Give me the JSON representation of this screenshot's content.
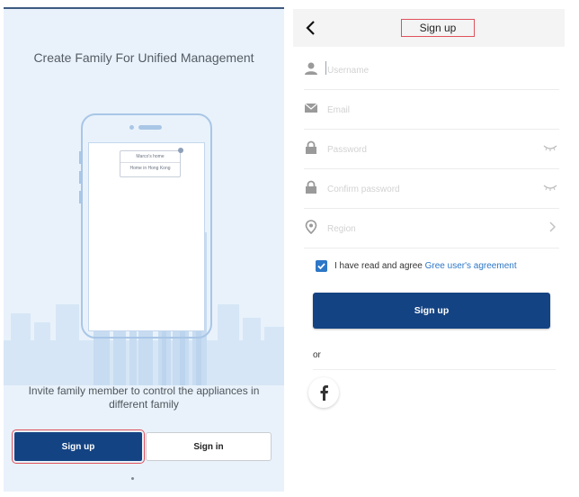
{
  "onboarding": {
    "title": "Create Family For Unified Management",
    "illustration": {
      "popup_line1": "Marco's home",
      "popup_line2": "Home in Hong Kong"
    },
    "invite_text": "Invite family member to control the appliances in different family",
    "signup_label": "Sign up",
    "signin_label": "Sign in",
    "page_indicator": {
      "pages": 1,
      "active": 1
    }
  },
  "signup_form": {
    "header": {
      "title": "Sign up",
      "back_icon": "chevron-left-icon"
    },
    "fields": {
      "username": {
        "placeholder": "Username",
        "value": "",
        "icon": "user-icon"
      },
      "email": {
        "placeholder": "Email",
        "value": "",
        "icon": "mail-icon"
      },
      "password": {
        "placeholder": "Password",
        "value": "",
        "icon": "lock-icon",
        "toggle_icon": "eye-closed-icon"
      },
      "confirm_password": {
        "placeholder": "Confirm password",
        "value": "",
        "icon": "lock-icon",
        "toggle_icon": "eye-closed-icon"
      },
      "region": {
        "placeholder": "Region",
        "value": "",
        "icon": "location-icon",
        "chevron_icon": "chevron-right-icon"
      }
    },
    "agreement": {
      "checked": true,
      "text": "I have read and agree ",
      "link_text": "Gree user's agreement"
    },
    "submit_label": "Sign up",
    "or_label": "or",
    "social": [
      {
        "name": "facebook",
        "icon": "facebook-icon"
      }
    ]
  },
  "colors": {
    "primary": "#144383",
    "link": "#2d77c7",
    "highlight_outline": "#e0515b",
    "left_background": "#e9f2fb",
    "header_background": "#f4f4f4",
    "placeholder": "#d2d2d2"
  }
}
